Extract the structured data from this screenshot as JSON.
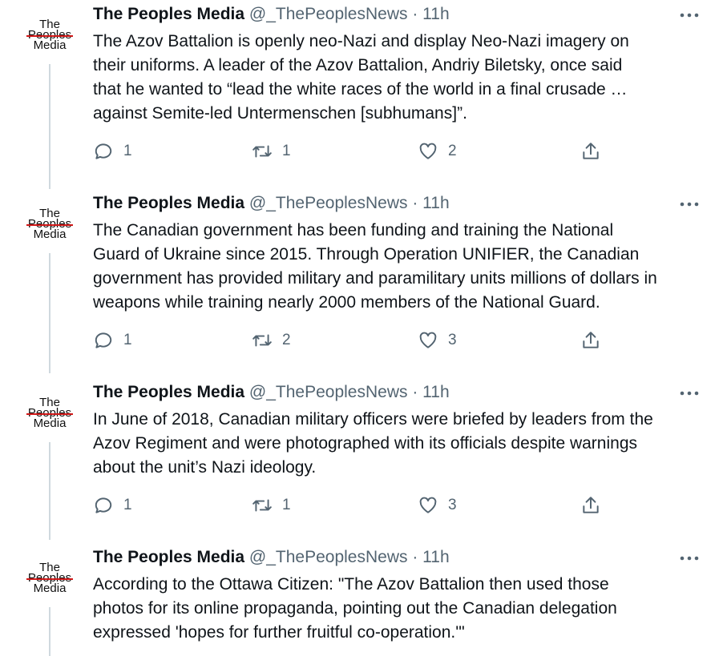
{
  "author": {
    "name": "The Peoples Media",
    "handle": "@_ThePeoplesNews",
    "avatar_lines": [
      "The",
      "Peoples",
      "Media"
    ]
  },
  "icons": {
    "more": "more-horizontal-icon",
    "reply": "reply-icon",
    "retweet": "retweet-icon",
    "like": "heart-icon",
    "share": "share-icon"
  },
  "colors": {
    "text": "#0f1419",
    "muted": "#536471",
    "thread_line": "#cfd9de",
    "logo_accent": "#d01818"
  },
  "tweets": [
    {
      "time": "· 11h",
      "text": "The Azov Battalion is openly neo-Nazi and display Neo-Nazi imagery on\ntheir uniforms. A leader of the Azov Battalion, Andriy Biletsky, once said\nthat he wanted to “lead the white races of the world in a final crusade …\nagainst Semite-led Untermenschen [subhumans]”.",
      "replies": "1",
      "retweets": "1",
      "likes": "2"
    },
    {
      "time": "· 11h",
      "text": "The Canadian government has been funding and training the National\nGuard of Ukraine since 2015. Through Operation UNIFIER, the Canadian\ngovernment has provided military and paramilitary units millions of dollars in\nweapons while training nearly 2000 members of the National Guard.",
      "replies": "1",
      "retweets": "2",
      "likes": "3"
    },
    {
      "time": "· 11h",
      "text": "In June of 2018, Canadian military officers were briefed by leaders from the\nAzov Regiment and were photographed with its officials despite warnings\nabout the unit’s Nazi ideology.",
      "replies": "1",
      "retweets": "1",
      "likes": "3"
    },
    {
      "time": "· 11h",
      "text": "According to the Ottawa Citizen: \"The Azov Battalion then used those\nphotos for its online propaganda, pointing out the Canadian delegation\nexpressed 'hopes for further fruitful co-operation.'\"",
      "replies": "",
      "retweets": "",
      "likes": ""
    }
  ]
}
